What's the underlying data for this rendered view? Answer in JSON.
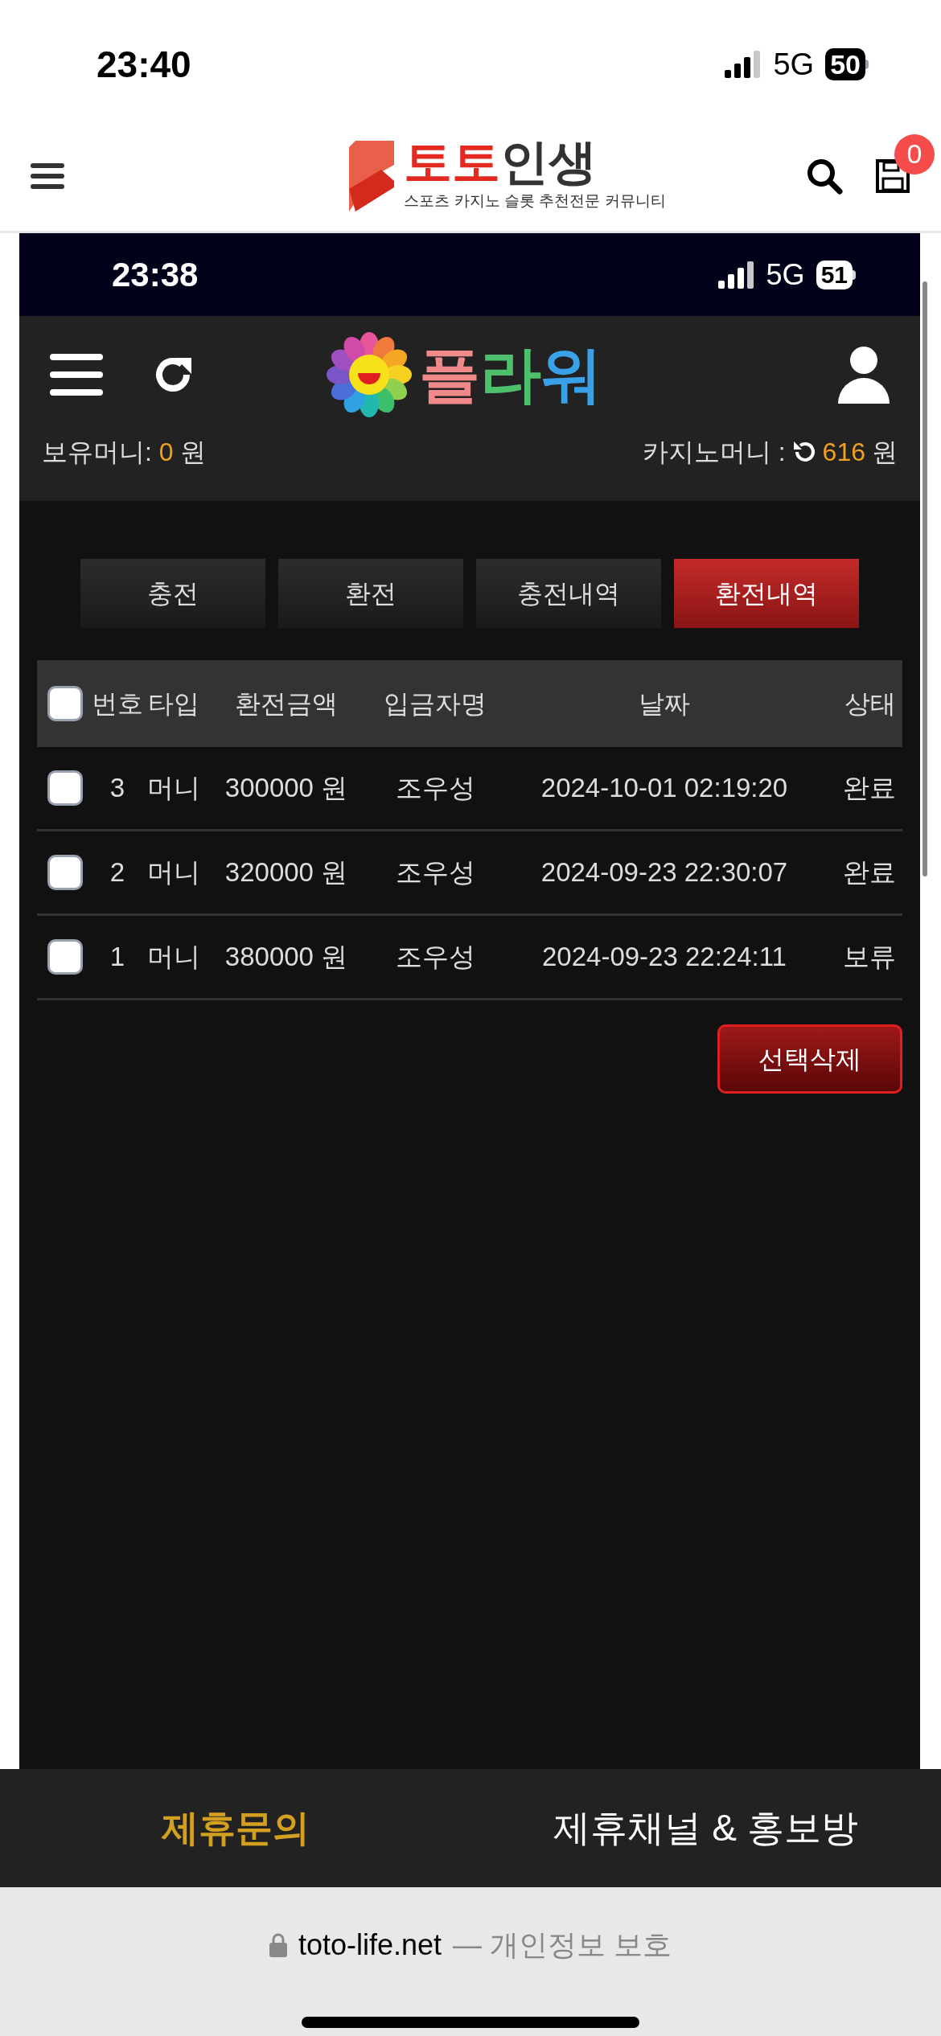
{
  "status_bar": {
    "time": "23:40",
    "network": "5G",
    "battery": "50"
  },
  "site_header": {
    "logo": {
      "brand_red": "토토",
      "brand_dark": "인생",
      "tagline": "스포츠 카지노 슬롯 추천전문 커뮤니티"
    },
    "cart_badge": "0"
  },
  "inner_screen": {
    "status_bar": {
      "time": "23:38",
      "network": "5G",
      "battery": "51"
    },
    "app_header": {
      "logo_text": "플라워"
    },
    "balance": {
      "label": "보유머니:",
      "amount": "0",
      "unit": "원"
    },
    "casino_balance": {
      "label": "카지노머니 :",
      "amount": "616",
      "unit": "원"
    },
    "tabs": [
      {
        "label": "충전",
        "selected": false
      },
      {
        "label": "환전",
        "selected": false
      },
      {
        "label": "충전내역",
        "selected": false
      },
      {
        "label": "환전내역",
        "selected": true
      }
    ],
    "table": {
      "select_all_checked": false,
      "columns": [
        "번호",
        "타입",
        "환전금액",
        "입금자명",
        "날짜",
        "상태"
      ],
      "rows": [
        {
          "checked": false,
          "cells": [
            "3",
            "머니",
            "300000 원",
            "조우성",
            "2024-10-01 02:19:20",
            "완료"
          ]
        },
        {
          "checked": false,
          "cells": [
            "2",
            "머니",
            "320000 원",
            "조우성",
            "2024-09-23 22:30:07",
            "완료"
          ]
        },
        {
          "checked": false,
          "cells": [
            "1",
            "머니",
            "380000 원",
            "조우성",
            "2024-09-23 22:24:11",
            "보류"
          ]
        }
      ]
    },
    "delete_button": "선택삭제"
  },
  "footer": {
    "links": [
      {
        "label": "제휴문의",
        "selected": true
      },
      {
        "label": "제휴채널 & 홍보방",
        "selected": false
      }
    ]
  },
  "url_bar": {
    "domain": "toto-life.net",
    "privacy": "— 개인정보 보호"
  }
}
